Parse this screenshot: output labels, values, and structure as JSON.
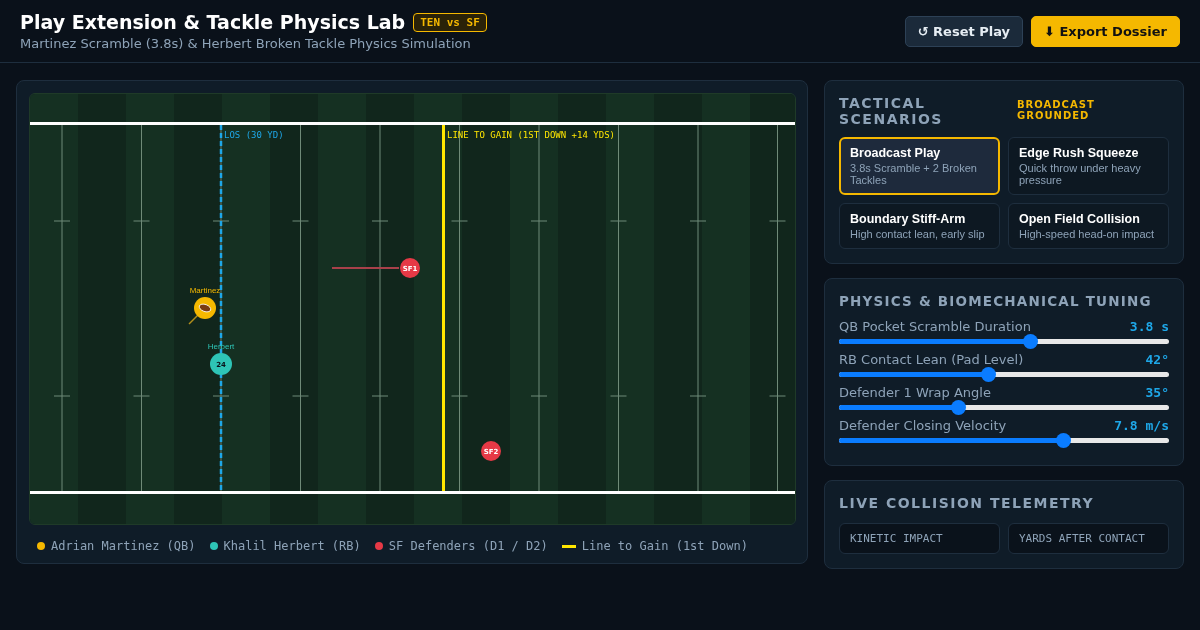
{
  "header": {
    "title": "Play Extension & Tackle Physics Lab",
    "badge": "TEN vs SF",
    "subtitle": "Martinez Scramble (3.8s) & Herbert Broken Tackle Physics Simulation",
    "buttons": [
      {
        "kind": "reset",
        "icon": "↺",
        "label": "Reset Play"
      },
      {
        "kind": "export",
        "icon": "⬇",
        "label": "Export Dossier"
      }
    ]
  },
  "field": {
    "los_label": "LOS (30 YD)",
    "ltg_label": "LINE TO GAIN (1ST DOWN +14 YDS)",
    "players": [
      {
        "kind": "qb",
        "label": "Martinez",
        "color": "#f5b800",
        "trail": true
      },
      {
        "kind": "rb",
        "label": "Herbert",
        "number": "24",
        "color": "#2ec4b6",
        "trail": false
      },
      {
        "kind": "defender",
        "number": "SF1",
        "color": "#e63946",
        "trail": true
      },
      {
        "kind": "defender",
        "number": "SF2",
        "color": "#e63946",
        "trail": false
      }
    ],
    "legend": [
      {
        "kind": "dot",
        "label": "Adrian Martinez (QB)",
        "color": "#f5b800"
      },
      {
        "kind": "dot",
        "label": "Khalil Herbert (RB)",
        "color": "#2ec4b6"
      },
      {
        "kind": "dot",
        "label": "SF Defenders (D1 / D2)",
        "color": "#e63946"
      },
      {
        "kind": "line",
        "label": "Line to Gain (1st Down)",
        "color": "#ffe600"
      }
    ]
  },
  "scenarios": {
    "title": "TACTICAL SCENARIOS",
    "tag": "BROADCAST GROUNDED",
    "items": [
      {
        "name": "Broadcast Play",
        "desc": "3.8s Scramble + 2 Broken Tackles",
        "selected": true
      },
      {
        "name": "Edge Rush Squeeze",
        "desc": "Quick throw under heavy pressure",
        "selected": false
      },
      {
        "name": "Boundary Stiff-Arm",
        "desc": "High contact lean, early slip",
        "selected": false
      },
      {
        "name": "Open Field Collision",
        "desc": "High-speed head-on impact",
        "selected": false
      }
    ]
  },
  "tuning": {
    "title": "PHYSICS & BIOMECHANICAL TUNING",
    "sliders": [
      {
        "label": "QB Pocket Scramble Duration",
        "reading": "3.8 s",
        "level": 0.58
      },
      {
        "label": "RB Contact Lean (Pad Level)",
        "reading": "42°",
        "level": 0.45
      },
      {
        "label": "Defender 1 Wrap Angle",
        "reading": "35°",
        "level": 0.36
      },
      {
        "label": "Defender Closing Velocity",
        "reading": "7.8 m/s",
        "level": 0.68
      }
    ]
  },
  "telemetry": {
    "title": "LIVE COLLISION TELEMETRY",
    "cards": [
      "KINETIC IMPACT",
      "YARDS AFTER CONTACT"
    ]
  }
}
